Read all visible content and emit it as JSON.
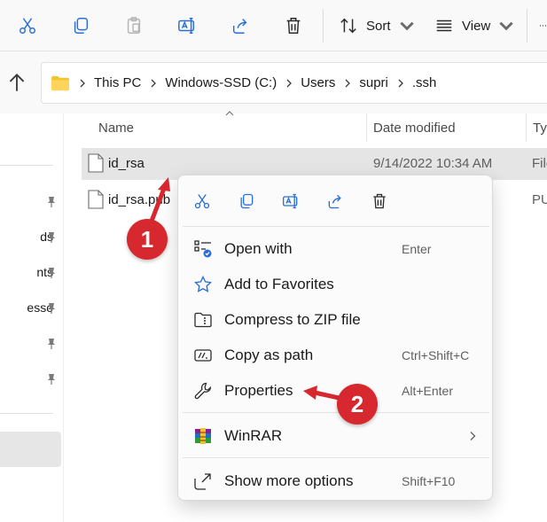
{
  "toolbar": {
    "sort_label": "Sort",
    "view_label": "View",
    "icons": [
      "cut-icon",
      "copy-icon",
      "paste-icon",
      "rename-icon",
      "share-icon",
      "delete-icon",
      "sort-icon",
      "view-icon",
      "more-icon"
    ]
  },
  "address": {
    "crumbs": [
      "This PC",
      "Windows-SSD (C:)",
      "Users",
      "supri",
      ".ssh"
    ]
  },
  "nav": {
    "items": [
      "ds",
      "nts",
      "esso"
    ]
  },
  "columns": {
    "name": "Name",
    "date": "Date modified",
    "type": "Typ"
  },
  "files": [
    {
      "name": "id_rsa",
      "date": "9/14/2022 10:34 AM",
      "type": "File"
    },
    {
      "name": "id_rsa.pub",
      "date": "",
      "type": "PUB"
    }
  ],
  "context_menu": {
    "quick_actions": [
      "cut-icon",
      "copy-icon",
      "rename-icon",
      "share-icon",
      "delete-icon"
    ],
    "items": [
      {
        "label": "Open with",
        "shortcut": "Enter"
      },
      {
        "label": "Add to Favorites",
        "shortcut": ""
      },
      {
        "label": "Compress to ZIP file",
        "shortcut": ""
      },
      {
        "label": "Copy as path",
        "shortcut": "Ctrl+Shift+C"
      },
      {
        "label": "Properties",
        "shortcut": "Alt+Enter"
      },
      {
        "label": "WinRAR",
        "shortcut": ""
      },
      {
        "label": "Show more options",
        "shortcut": "Shift+F10"
      }
    ]
  },
  "annotations": {
    "step1": "1",
    "step2": "2",
    "color": "#d6282e"
  },
  "colors": {
    "accent": "#005fb8",
    "folder": "#f4c430",
    "selection": "#e5e5e5"
  }
}
